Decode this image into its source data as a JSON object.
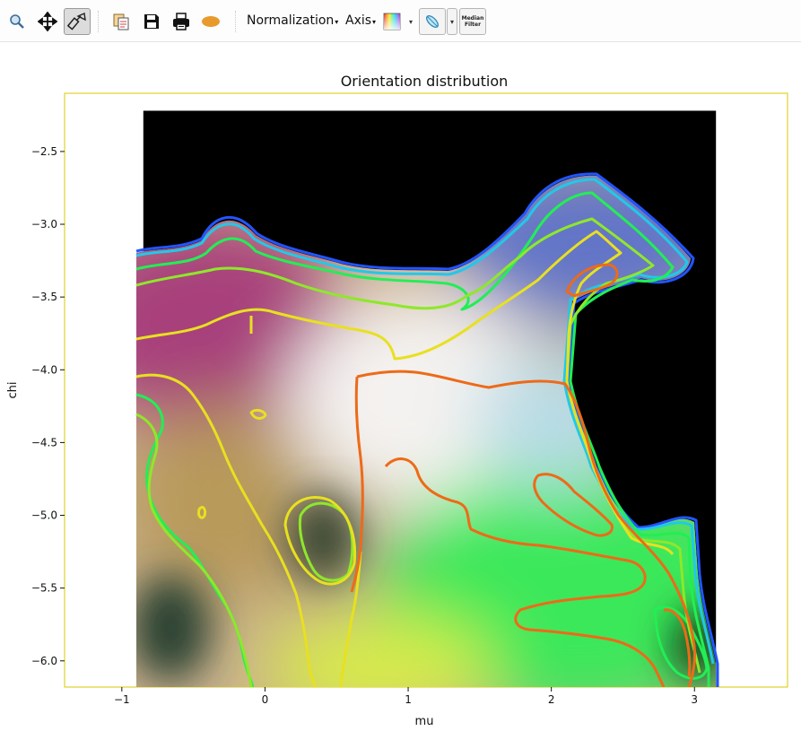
{
  "toolbar": {
    "normalization_label": "Normalization",
    "axis_label": "Axis",
    "median_filter_label_1": "Median",
    "median_filter_label_2": "Filter",
    "icons": [
      "zoom-icon",
      "pan-icon",
      "crosshair-icon",
      "copy-icon",
      "save-icon",
      "print-icon",
      "mask-icon",
      "colormap-icon",
      "roi-icon",
      "median-filter-icon"
    ]
  },
  "chart_data": {
    "type": "heatmap",
    "title": "Orientation distribution",
    "xlabel": "mu",
    "ylabel": "chi",
    "xlim": [
      -1.4,
      3.65
    ],
    "ylim": [
      -6.18,
      -2.1
    ],
    "x_ticks": [
      -1,
      0,
      1,
      2,
      3
    ],
    "y_ticks": [
      -2.5,
      -3.0,
      -3.5,
      -4.0,
      -4.5,
      -5.0,
      -5.5,
      -6.0
    ],
    "image_extent": {
      "x": [
        -0.85,
        3.15
      ],
      "y": [
        -6.18,
        -2.22
      ]
    },
    "colors": {
      "background": "#000000",
      "frame": "#d8c800",
      "magenta_region": "#b04a84",
      "white_region": "#f2f2f2",
      "blue_region": "#6a7fd0",
      "green_region": "#3ff25a",
      "yellow_region": "#d8f04a",
      "contour_levels": [
        "#2255ff",
        "#22c8e8",
        "#22ee55",
        "#8ee82a",
        "#e8e020",
        "#ee6a18"
      ]
    },
    "grid": false,
    "legend": "none"
  }
}
